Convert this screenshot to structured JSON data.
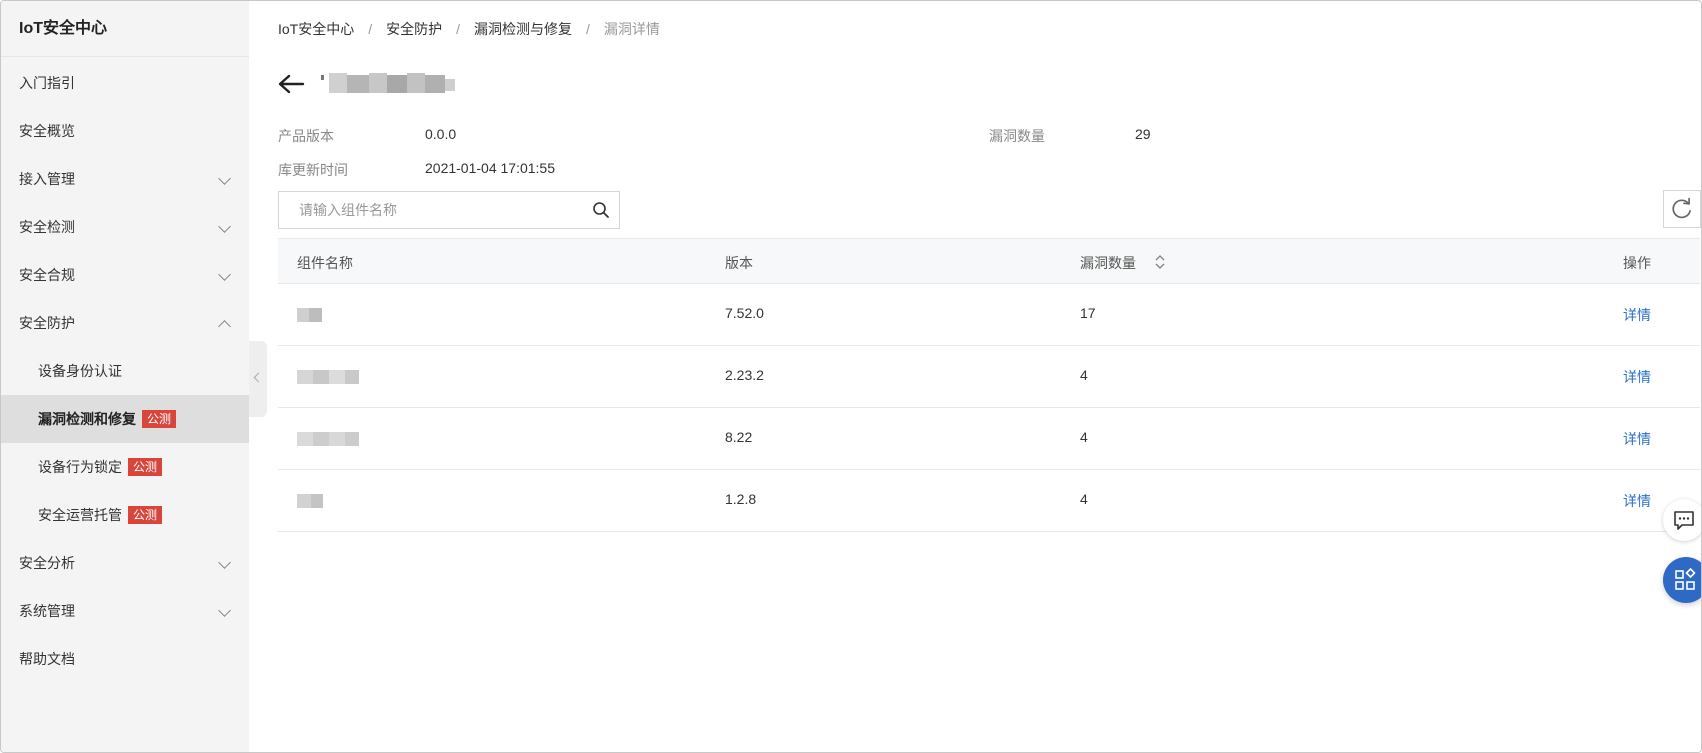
{
  "sidebar": {
    "title": "IoT安全中心",
    "items": [
      {
        "label": "入门指引",
        "type": "plain"
      },
      {
        "label": "安全概览",
        "type": "plain"
      },
      {
        "label": "接入管理",
        "type": "group",
        "expanded": false
      },
      {
        "label": "安全检测",
        "type": "group",
        "expanded": false
      },
      {
        "label": "安全合规",
        "type": "group",
        "expanded": false
      },
      {
        "label": "安全防护",
        "type": "group",
        "expanded": true
      },
      {
        "label": "设备身份认证",
        "type": "sub"
      },
      {
        "label": "漏洞检测和修复",
        "type": "sub",
        "active": true,
        "badge": "公测"
      },
      {
        "label": "设备行为锁定",
        "type": "sub",
        "badge": "公测"
      },
      {
        "label": "安全运营托管",
        "type": "sub",
        "badge": "公测"
      },
      {
        "label": "安全分析",
        "type": "group",
        "expanded": false
      },
      {
        "label": "系统管理",
        "type": "group",
        "expanded": false
      },
      {
        "label": "帮助文档",
        "type": "plain"
      }
    ]
  },
  "breadcrumb": [
    "IoT安全中心",
    "安全防护",
    "漏洞检测与修复",
    "漏洞详情"
  ],
  "info": {
    "product_version_label": "产品版本",
    "product_version": "0.0.0",
    "vuln_count_label": "漏洞数量",
    "vuln_count": "29",
    "db_update_label": "库更新时间",
    "db_update": "2021-01-04 17:01:55"
  },
  "search": {
    "placeholder": "请输入组件名称",
    "value": ""
  },
  "table": {
    "headers": {
      "name": "组件名称",
      "version": "版本",
      "vuln_count": "漏洞数量",
      "action": "操作"
    },
    "rows": [
      {
        "version": "7.52.0",
        "vuln_count": "17",
        "action": "详情"
      },
      {
        "version": "2.23.2",
        "vuln_count": "4",
        "action": "详情"
      },
      {
        "version": "8.22",
        "vuln_count": "4",
        "action": "详情"
      },
      {
        "version": "1.2.8",
        "vuln_count": "4",
        "action": "详情"
      }
    ]
  },
  "colors": {
    "accent": "#2f69c6",
    "link": "#2a6fc9",
    "badge": "#d7453b",
    "sidebar_bg": "#f4f4f4",
    "active_bg": "#dedede"
  },
  "icons": [
    "back-arrow-icon",
    "search-icon",
    "refresh-icon",
    "sort-icon",
    "chevron-down-icon",
    "chevron-up-icon",
    "chevron-left-icon",
    "message-icon",
    "apps-icon"
  ]
}
